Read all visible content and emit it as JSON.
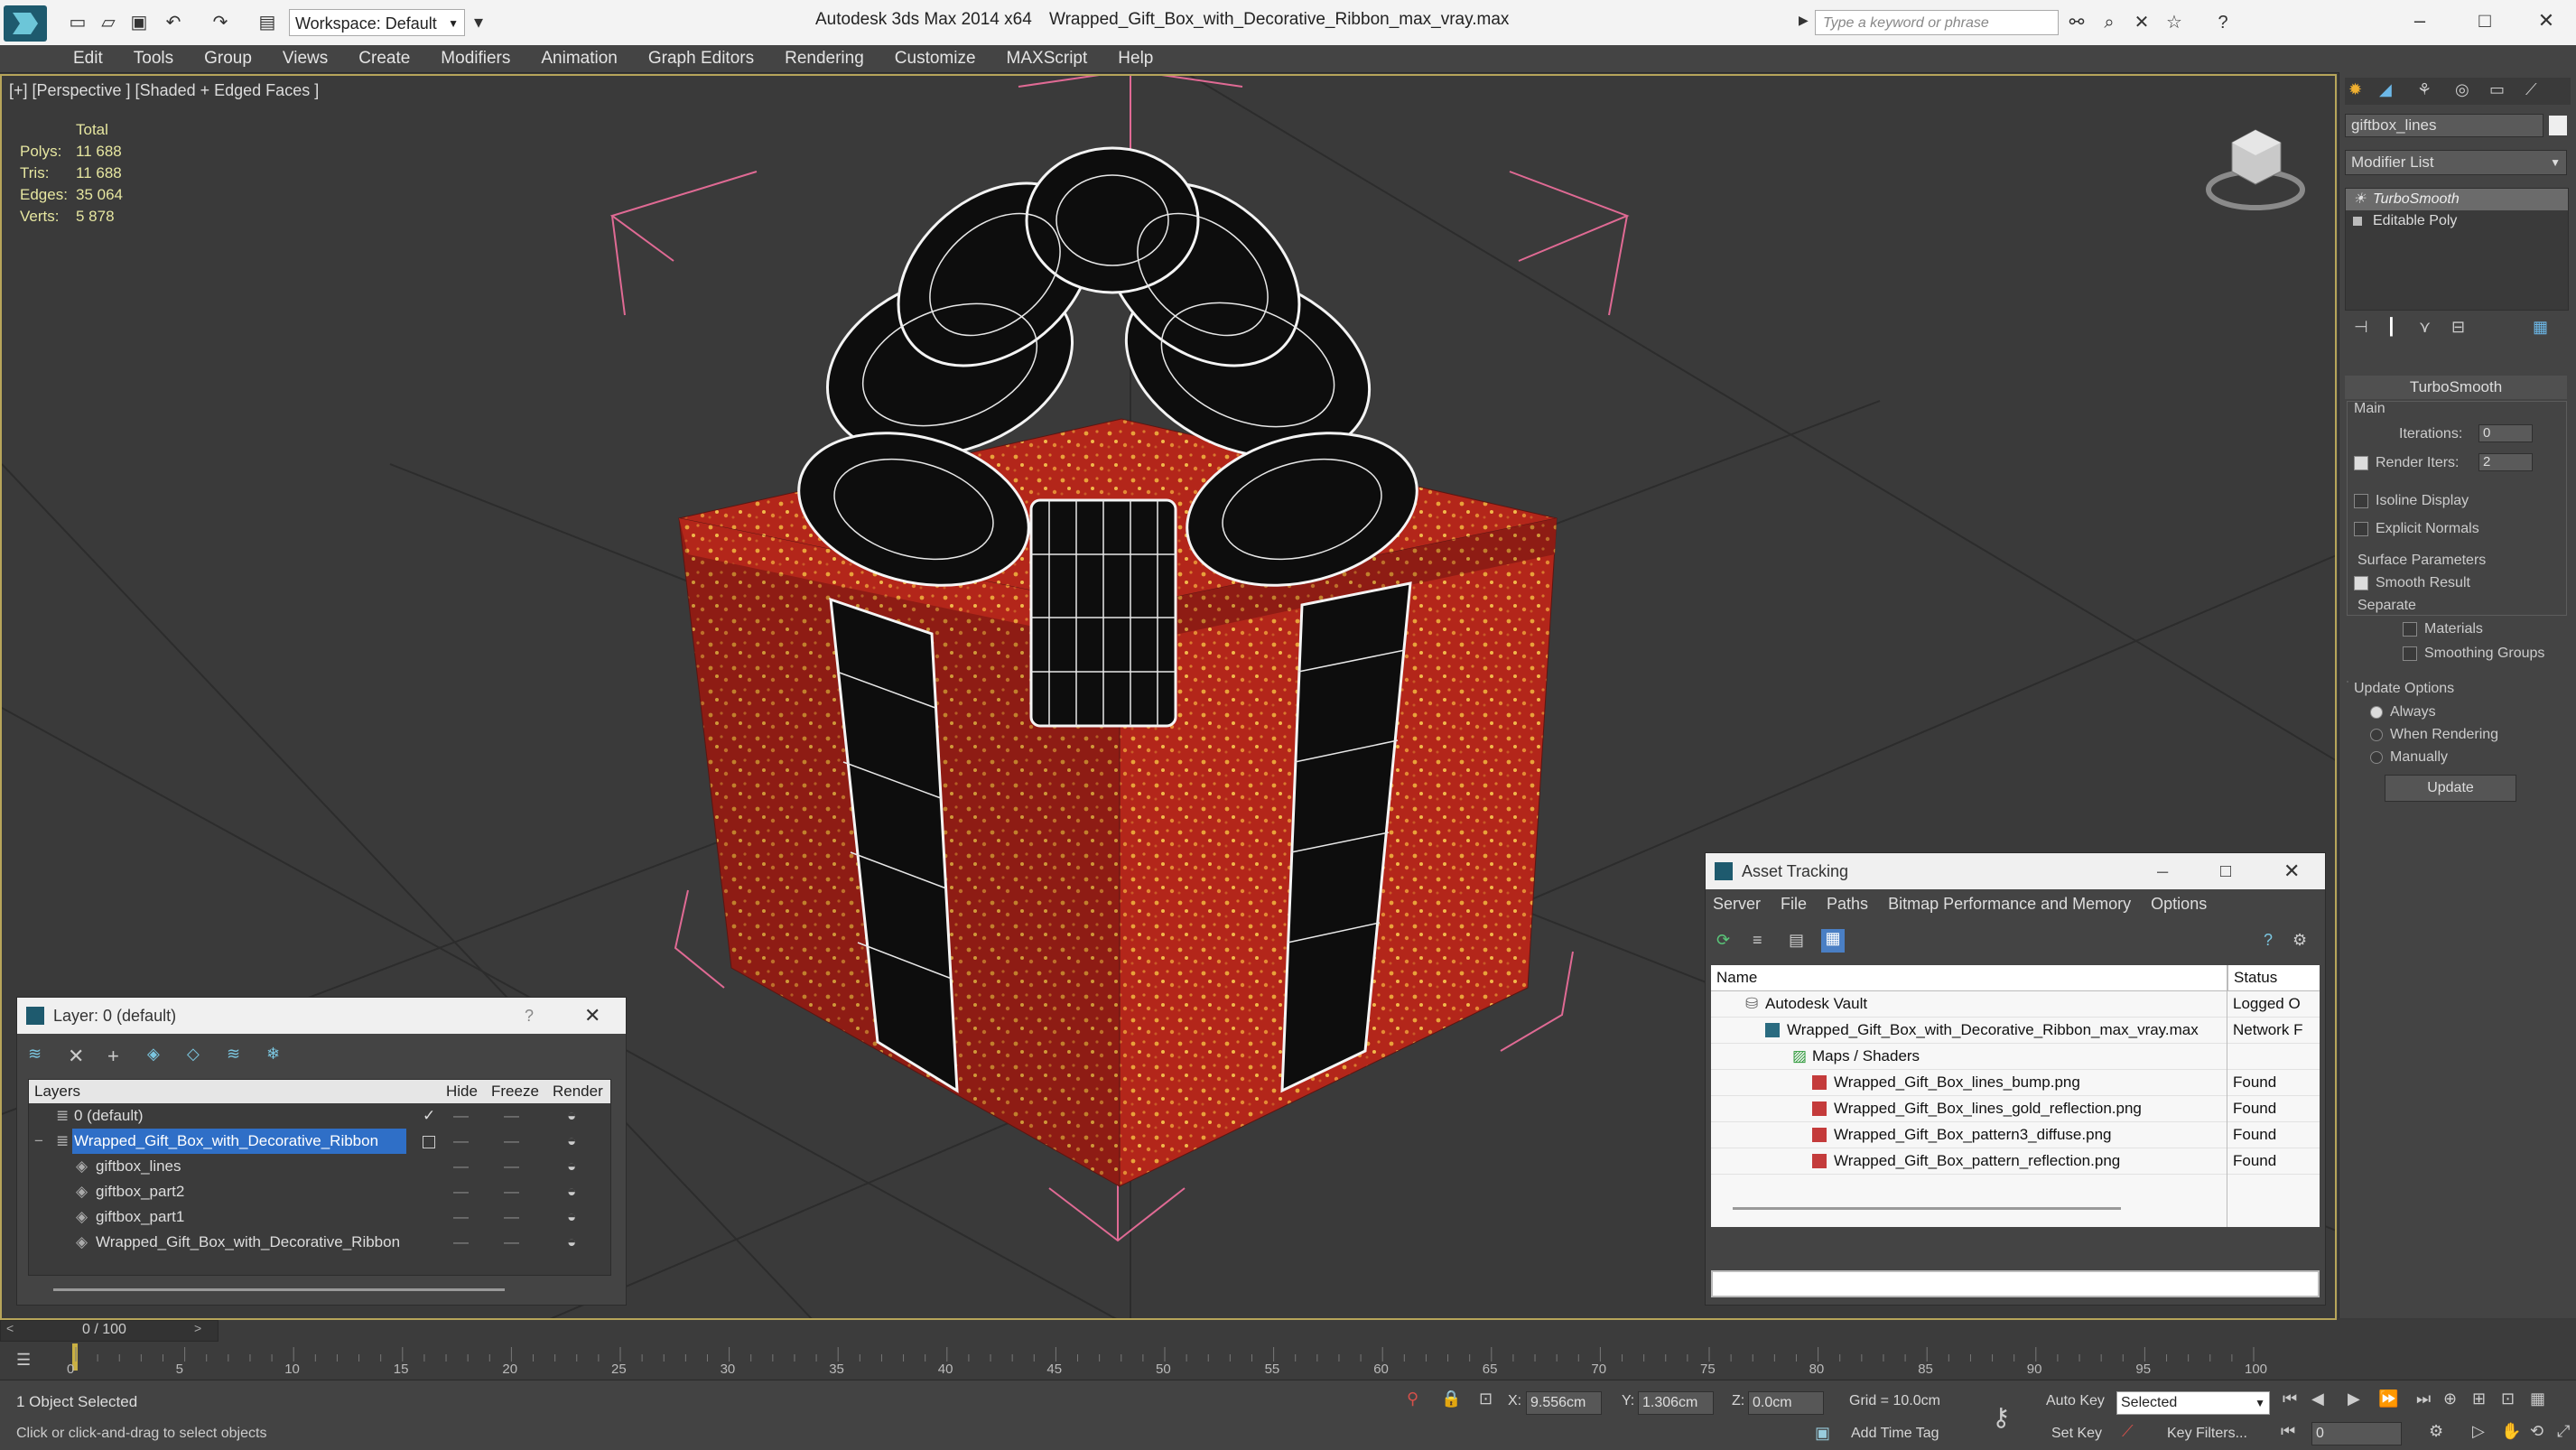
{
  "titlebar": {
    "workspace": "Workspace: Default",
    "app": "Autodesk 3ds Max  2014 x64",
    "file": "Wrapped_Gift_Box_with_Decorative_Ribbon_max_vray.max",
    "search_placeholder": "Type a keyword or phrase"
  },
  "menu": [
    "Edit",
    "Tools",
    "Group",
    "Views",
    "Create",
    "Modifiers",
    "Animation",
    "Graph Editors",
    "Rendering",
    "Customize",
    "MAXScript",
    "Help"
  ],
  "viewport": {
    "label": "[+] [Perspective ] [Shaded + Edged Faces ]",
    "stats": {
      "header": "Total",
      "rows": [
        {
          "label": "Polys:",
          "value": "11 688"
        },
        {
          "label": "Tris:",
          "value": "11 688"
        },
        {
          "label": "Edges:",
          "value": "35 064"
        },
        {
          "label": "Verts:",
          "value": "5 878"
        }
      ]
    }
  },
  "command_panel": {
    "object_name": "giftbox_lines",
    "modifier_list": "Modifier List",
    "stack": [
      "TurboSmooth",
      "Editable Poly"
    ],
    "rollout_title": "TurboSmooth",
    "main_label": "Main",
    "iterations_label": "Iterations:",
    "iterations_value": "0",
    "render_iters_label": "Render Iters:",
    "render_iters_value": "2",
    "isoline": "Isoline Display",
    "explicit": "Explicit Normals",
    "surface_params": "Surface Parameters",
    "smooth_result": "Smooth Result",
    "separate": "Separate",
    "materials": "Materials",
    "smoothing_groups": "Smoothing Groups",
    "update_options": "Update Options",
    "always": "Always",
    "when_rendering": "When Rendering",
    "manually": "Manually",
    "update_button": "Update"
  },
  "layer_window": {
    "title": "Layer: 0 (default)",
    "help": "?",
    "columns": {
      "layers": "Layers",
      "hide": "Hide",
      "freeze": "Freeze",
      "render": "Render"
    },
    "rows": [
      {
        "name": "0 (default)"
      },
      {
        "name": "Wrapped_Gift_Box_with_Decorative_Ribbon"
      },
      {
        "name": "giftbox_lines"
      },
      {
        "name": "giftbox_part2"
      },
      {
        "name": "giftbox_part1"
      },
      {
        "name": "Wrapped_Gift_Box_with_Decorative_Ribbon"
      }
    ]
  },
  "asset_window": {
    "title": "Asset Tracking",
    "menu": [
      "Server",
      "File",
      "Paths",
      "Bitmap Performance and Memory",
      "Options"
    ],
    "columns": {
      "name": "Name",
      "status": "Status"
    },
    "rows": [
      {
        "name": "Autodesk Vault",
        "status": "Logged O"
      },
      {
        "name": "Wrapped_Gift_Box_with_Decorative_Ribbon_max_vray.max",
        "status": "Network F"
      },
      {
        "name": "Maps / Shaders",
        "status": ""
      },
      {
        "name": "Wrapped_Gift_Box_lines_bump.png",
        "status": "Found"
      },
      {
        "name": "Wrapped_Gift_Box_lines_gold_reflection.png",
        "status": "Found"
      },
      {
        "name": "Wrapped_Gift_Box_pattern3_diffuse.png",
        "status": "Found"
      },
      {
        "name": "Wrapped_Gift_Box_pattern_reflection.png",
        "status": "Found"
      }
    ]
  },
  "timeline": {
    "frame": "0 / 100",
    "ticks": [
      "0",
      "5",
      "10",
      "15",
      "20",
      "25",
      "30",
      "35",
      "40",
      "45",
      "50",
      "55",
      "60",
      "65",
      "70",
      "75",
      "80",
      "85",
      "90",
      "95",
      "100"
    ]
  },
  "status": {
    "selected": "1 Object Selected",
    "prompt": "Click or click-and-drag to select objects",
    "x_label": "X:",
    "x_value": "9.556cm",
    "y_label": "Y:",
    "y_value": "1.306cm",
    "z_label": "Z:",
    "z_value": "0.0cm",
    "grid": "Grid = 10.0cm",
    "add_time_tag": "Add Time Tag",
    "auto_key": "Auto Key",
    "set_key": "Set Key",
    "selected_dropdown": "Selected",
    "key_filters": "Key Filters...",
    "frame_field": "0"
  }
}
